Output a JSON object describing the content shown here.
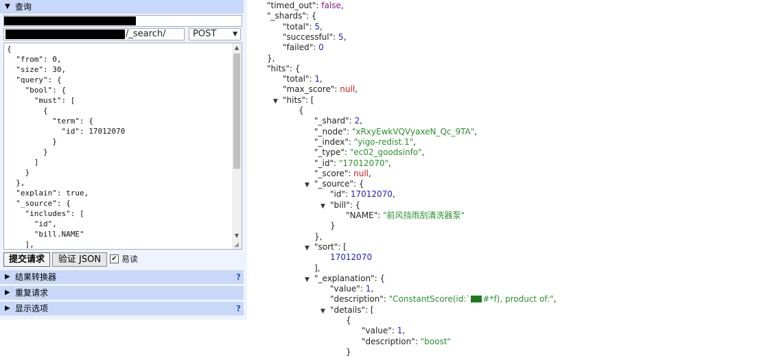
{
  "left": {
    "query_section": {
      "toggle": "▼",
      "title": "查询"
    },
    "path_suffix": "/_search/",
    "method": {
      "value": "POST",
      "arrow": "▼"
    },
    "editor_text": "{\n  \"from\": 0,\n  \"size\": 30,\n  \"query\": {\n    \"bool\": {\n      \"must\": [\n        {\n          \"term\": {\n            \"id\": 17012070\n          }\n        }\n      ]\n    }\n  },\n  \"explain\": true,\n  \"_source\": {\n    \"includes\": [\n      \"id\",\n      \"bill.NAME\"\n    ],",
    "buttons": {
      "submit": "提交请求",
      "validate": "验证 JSON"
    },
    "easy_read": {
      "label": "易读",
      "checked": true
    },
    "sections": [
      {
        "toggle": "▶",
        "title": "结果转换器",
        "help": "?"
      },
      {
        "toggle": "▶",
        "title": "重复请求",
        "help": ""
      },
      {
        "toggle": "▶",
        "title": "显示选项",
        "help": "?"
      }
    ]
  },
  "viewer": {
    "lines": [
      {
        "indent": 0,
        "tog": "",
        "key": "timed_out",
        "val": "false",
        "vt": "b",
        "tail": ","
      },
      {
        "indent": 0,
        "tog": "▼",
        "key": "_shards",
        "val": "",
        "vt": "",
        "tail": "{"
      },
      {
        "indent": 1,
        "tog": "",
        "key": "total",
        "val": "5",
        "vt": "n",
        "tail": ","
      },
      {
        "indent": 1,
        "tog": "",
        "key": "successful",
        "val": "5",
        "vt": "n",
        "tail": ","
      },
      {
        "indent": 1,
        "tog": "",
        "key": "failed",
        "val": "0",
        "vt": "n",
        "tail": ""
      },
      {
        "indent": 0,
        "tog": "",
        "key": "",
        "val": "",
        "vt": "",
        "tail": "},"
      },
      {
        "indent": 0,
        "tog": "▼",
        "key": "hits",
        "val": "",
        "vt": "",
        "tail": "{"
      },
      {
        "indent": 1,
        "tog": "",
        "key": "total",
        "val": "1",
        "vt": "n",
        "tail": ","
      },
      {
        "indent": 1,
        "tog": "",
        "key": "max_score",
        "val": "null",
        "vt": "nl",
        "tail": ","
      },
      {
        "indent": 1,
        "tog": "▼",
        "key": "hits",
        "val": "",
        "vt": "",
        "tail": "["
      },
      {
        "indent": 2,
        "tog": "",
        "key": "",
        "val": "",
        "vt": "",
        "tail": "{"
      },
      {
        "indent": 3,
        "tog": "",
        "key": "_shard",
        "val": "2",
        "vt": "n",
        "tail": ","
      },
      {
        "indent": 3,
        "tog": "",
        "key": "_node",
        "val": "\"xRxyEwkVQVyaxeN_Qc_9TA\"",
        "vt": "s",
        "tail": ","
      },
      {
        "indent": 3,
        "tog": "",
        "key": "_index",
        "val": "\"yigo-redist.1\"",
        "vt": "s",
        "tail": ","
      },
      {
        "indent": 3,
        "tog": "",
        "key": "_type",
        "val": "\"ec02_goodsinfo\"",
        "vt": "s",
        "tail": ","
      },
      {
        "indent": 3,
        "tog": "",
        "key": "_id",
        "val": "\"17012070\"",
        "vt": "s",
        "tail": ","
      },
      {
        "indent": 3,
        "tog": "",
        "key": "_score",
        "val": "null",
        "vt": "nl",
        "tail": ","
      },
      {
        "indent": 3,
        "tog": "▼",
        "key": "_source",
        "val": "",
        "vt": "",
        "tail": "{"
      },
      {
        "indent": 4,
        "tog": "",
        "key": "id",
        "val": "17012070",
        "vt": "n",
        "tail": ","
      },
      {
        "indent": 4,
        "tog": "▼",
        "key": "bill",
        "val": "",
        "vt": "",
        "tail": "{"
      },
      {
        "indent": 5,
        "tog": "",
        "key": "NAME",
        "val": "\"前风挡雨刮清洗器泵\"",
        "vt": "s",
        "tail": ""
      },
      {
        "indent": 4,
        "tog": "",
        "key": "",
        "val": "",
        "vt": "",
        "tail": "}"
      },
      {
        "indent": 3,
        "tog": "",
        "key": "",
        "val": "",
        "vt": "",
        "tail": "},"
      },
      {
        "indent": 3,
        "tog": "▼",
        "key": "sort",
        "val": "",
        "vt": "",
        "tail": "["
      },
      {
        "indent": 4,
        "tog": "",
        "key": "",
        "val": "17012070",
        "vt": "n",
        "tail": ""
      },
      {
        "indent": 3,
        "tog": "",
        "key": "",
        "val": "",
        "vt": "",
        "tail": "],"
      },
      {
        "indent": 3,
        "tog": "▼",
        "key": "_explanation",
        "val": "",
        "vt": "",
        "tail": "{"
      },
      {
        "indent": 4,
        "tog": "",
        "key": "value",
        "val": "1",
        "vt": "n",
        "tail": ","
      },
      {
        "indent": 4,
        "tog": "",
        "key": "description",
        "val": "\"ConstantScore(id:`",
        "vt": "s",
        "tail": ",",
        "glyph": true,
        "val2": "#*f), product of:\""
      },
      {
        "indent": 4,
        "tog": "▼",
        "key": "details",
        "val": "",
        "vt": "",
        "tail": "["
      },
      {
        "indent": 5,
        "tog": "",
        "key": "",
        "val": "",
        "vt": "",
        "tail": "{"
      },
      {
        "indent": 6,
        "tog": "",
        "key": "value",
        "val": "1",
        "vt": "n",
        "tail": ","
      },
      {
        "indent": 6,
        "tog": "",
        "key": "description",
        "val": "\"boost\"",
        "vt": "s",
        "tail": ""
      },
      {
        "indent": 5,
        "tog": "",
        "key": "",
        "val": "",
        "vt": "",
        "tail": "}"
      }
    ]
  }
}
